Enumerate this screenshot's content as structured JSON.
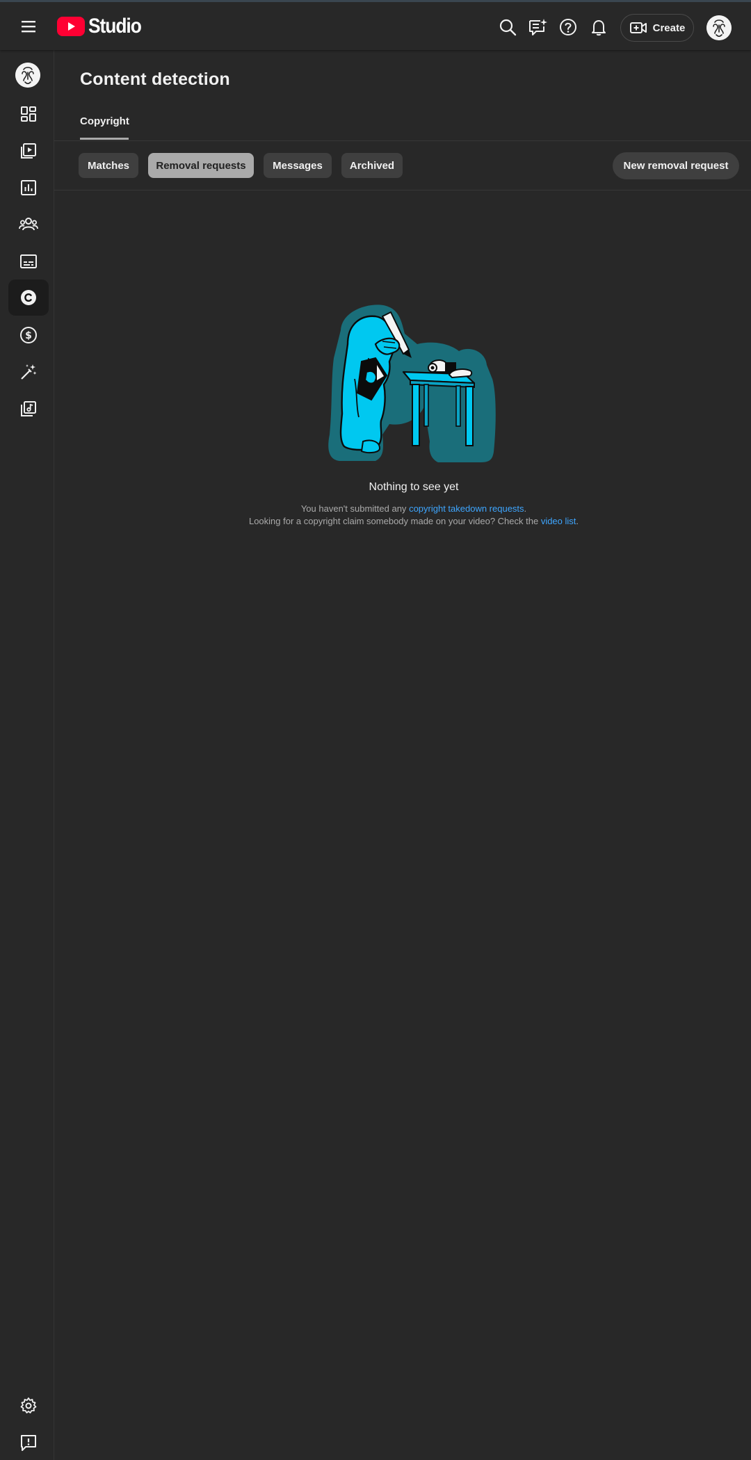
{
  "header": {
    "logo_text": "Studio",
    "create_label": "Create",
    "icons": [
      "menu-icon",
      "search-icon",
      "comments-icon",
      "help-icon",
      "notifications-icon",
      "create-video-icon"
    ]
  },
  "sidebar": {
    "items": [
      {
        "name": "dashboard",
        "icon": "dashboard-icon"
      },
      {
        "name": "content",
        "icon": "content-icon"
      },
      {
        "name": "analytics",
        "icon": "analytics-icon"
      },
      {
        "name": "community",
        "icon": "community-icon"
      },
      {
        "name": "subtitles",
        "icon": "subtitles-icon"
      },
      {
        "name": "copyright",
        "icon": "copyright-icon",
        "active": true
      },
      {
        "name": "earn",
        "icon": "earn-icon"
      },
      {
        "name": "customization",
        "icon": "magic-wand-icon"
      },
      {
        "name": "audio-library",
        "icon": "audio-library-icon"
      }
    ],
    "bottom": [
      {
        "name": "settings",
        "icon": "settings-icon"
      },
      {
        "name": "feedback",
        "icon": "feedback-icon"
      }
    ]
  },
  "page": {
    "title": "Content detection",
    "tab": "Copyright"
  },
  "filters": {
    "chips": [
      "Matches",
      "Removal requests",
      "Messages",
      "Archived"
    ],
    "selected": "Removal requests",
    "new_request_label": "New removal request"
  },
  "empty_state": {
    "title": "Nothing to see yet",
    "line1_prefix": "You haven't submitted any ",
    "line1_link": "copyright takedown requests",
    "line1_suffix": ".",
    "line2_prefix": "Looking for a copyright claim somebody made on your video? Check the ",
    "line2_link": "video list",
    "line2_suffix": "."
  },
  "colors": {
    "background": "#282828",
    "brand_red": "#ff0033",
    "chip": "#3f3f3f",
    "chip_selected": "#aaaaaa",
    "link": "#3ea6ff",
    "illustration_cyan": "#00c8f0",
    "illustration_teal": "#1a6e7a"
  }
}
